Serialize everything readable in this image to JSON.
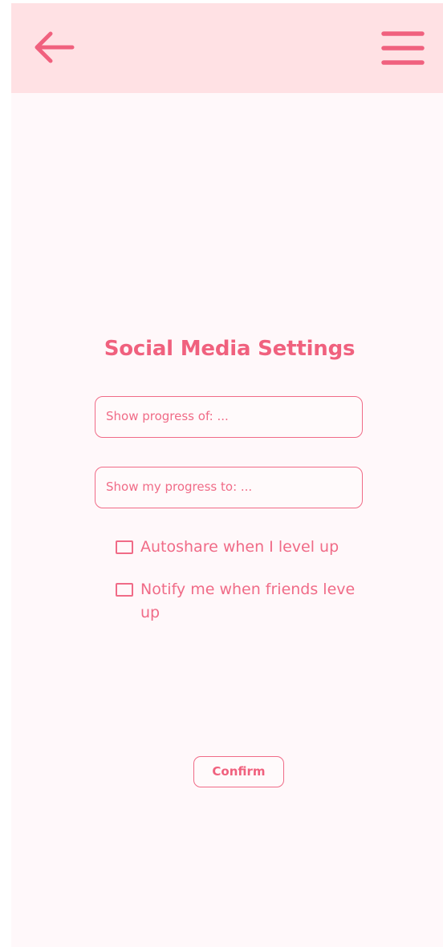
{
  "header": {
    "back_icon": "arrow-left-icon",
    "menu_icon": "hamburger-menu-icon"
  },
  "page": {
    "title": "Social Media Settings"
  },
  "fields": {
    "show_progress_of": "Show progress of: ...",
    "show_my_progress_to": "Show my progress to: ..."
  },
  "options": [
    {
      "label": "Autoshare when I level up",
      "checked": false
    },
    {
      "label": "Notify me when friends leve up",
      "checked": false
    }
  ],
  "actions": {
    "confirm_label": "Confirm"
  },
  "colors": {
    "accent": "#f0617e",
    "header_bg": "#ffe1e4",
    "page_bg": "#fff8fa"
  }
}
